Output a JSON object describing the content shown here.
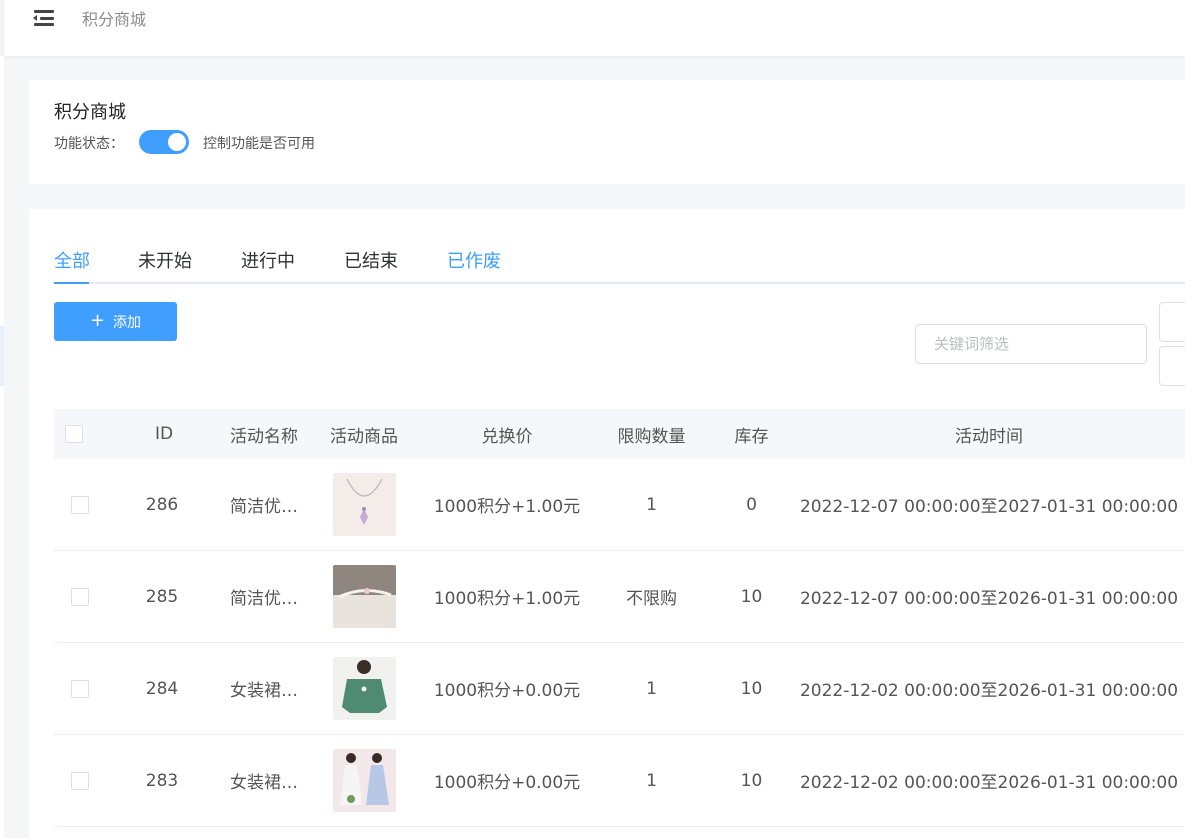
{
  "breadcrumb": "积分商城",
  "section": {
    "title": "积分商城",
    "status_label": "功能状态：",
    "status_desc": "控制功能是否可用",
    "status_enabled": true
  },
  "tabs": [
    {
      "label": "全部"
    },
    {
      "label": "未开始"
    },
    {
      "label": "进行中"
    },
    {
      "label": "已结束"
    },
    {
      "label": "已作废"
    }
  ],
  "toolbar": {
    "add_label": "添加",
    "search_placeholder": "关键词筛选"
  },
  "table": {
    "headers": {
      "id": "ID",
      "name": "活动名称",
      "product": "活动商品",
      "price": "兑换价",
      "limit": "限购数量",
      "stock": "库存",
      "time": "活动时间"
    },
    "rows": [
      {
        "id": "286",
        "name": "简洁优…",
        "price": "1000积分+1.00元",
        "limit": "1",
        "stock": "0",
        "time": "2022-12-07 00:00:00至2027-01-31 00:00:00"
      },
      {
        "id": "285",
        "name": "简洁优…",
        "price": "1000积分+1.00元",
        "limit": "不限购",
        "stock": "10",
        "time": "2022-12-07 00:00:00至2026-01-31 00:00:00"
      },
      {
        "id": "284",
        "name": "女装裙…",
        "price": "1000积分+0.00元",
        "limit": "1",
        "stock": "10",
        "time": "2022-12-02 00:00:00至2026-01-31 00:00:00"
      },
      {
        "id": "283",
        "name": "女装裙…",
        "price": "1000积分+0.00元",
        "limit": "1",
        "stock": "10",
        "time": "2022-12-02 00:00:00至2026-01-31 00:00:00"
      }
    ]
  },
  "colors": {
    "accent": "#409eff",
    "header_bg": "#f5f7fa",
    "text": "#555555"
  }
}
